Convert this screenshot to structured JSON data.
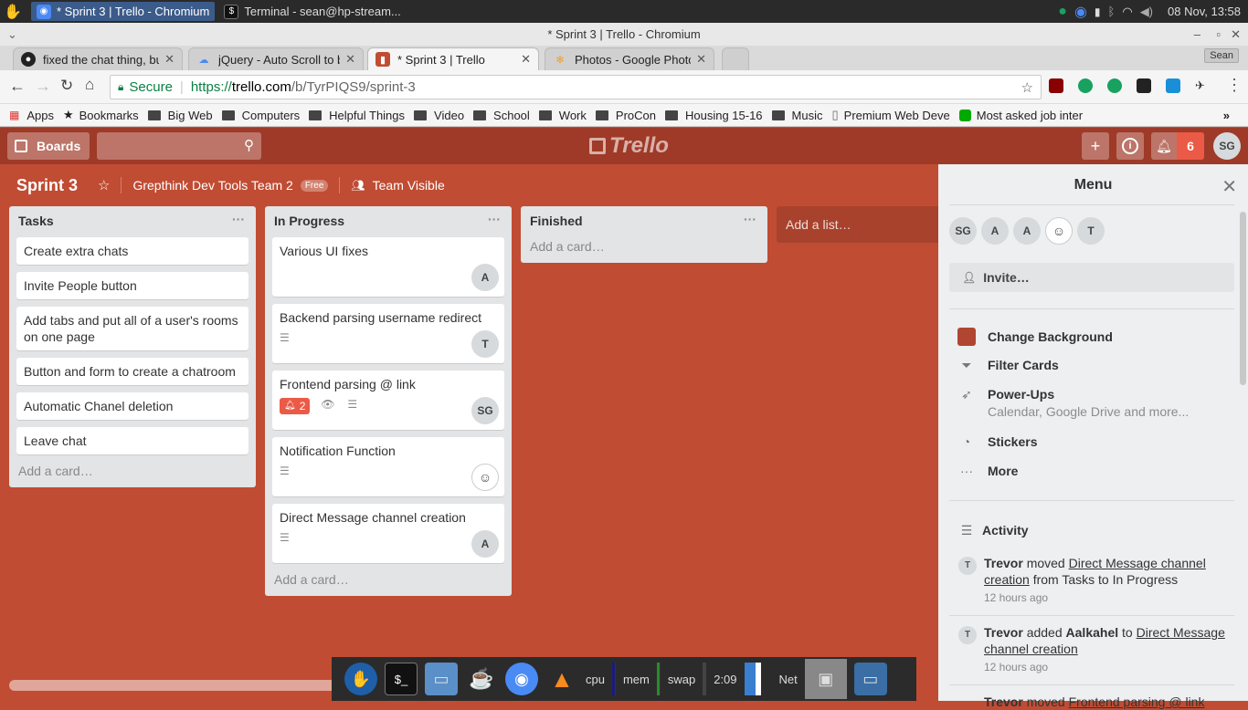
{
  "os": {
    "tasks": [
      {
        "label": "* Sprint 3 | Trello - Chromium",
        "icon": "chromium-icon"
      },
      {
        "label": "Terminal - sean@hp-stream...",
        "icon": "terminal-icon"
      }
    ],
    "clock": "08 Nov, 13:58"
  },
  "window": {
    "title": "* Sprint 3 | Trello - Chromium"
  },
  "tabs": [
    {
      "label": "fixed the chat thing, but",
      "icon": "github-icon"
    },
    {
      "label": "jQuery - Auto Scroll to b",
      "icon": "cloud-icon"
    },
    {
      "label": "* Sprint 3 | Trello",
      "icon": "trello-icon"
    },
    {
      "label": "Photos - Google Photos",
      "icon": "google-photos-icon"
    }
  ],
  "address": {
    "secure_label": "Secure",
    "url_prefix": "https://",
    "url_domain": "trello.com",
    "url_path": "/b/TyrPIQS9/sprint-3"
  },
  "profile_name": "Sean",
  "bookmarks": [
    {
      "label": "Apps",
      "icon": "apps-icon"
    },
    {
      "label": "Bookmarks",
      "icon": "star-icon"
    },
    {
      "label": "Big Web",
      "icon": "folder-icon"
    },
    {
      "label": "Computers",
      "icon": "folder-icon"
    },
    {
      "label": "Helpful Things",
      "icon": "folder-icon"
    },
    {
      "label": "Video",
      "icon": "folder-icon"
    },
    {
      "label": "School",
      "icon": "folder-icon"
    },
    {
      "label": "Work",
      "icon": "folder-icon"
    },
    {
      "label": "ProCon",
      "icon": "folder-icon"
    },
    {
      "label": "Housing 15-16",
      "icon": "folder-icon"
    },
    {
      "label": "Music",
      "icon": "folder-icon"
    },
    {
      "label": "Premium Web Deve",
      "icon": "page-icon"
    },
    {
      "label": "Most asked job inter",
      "icon": "site-icon"
    }
  ],
  "header": {
    "boards_label": "Boards",
    "logo": "Trello",
    "notif_count": "6",
    "user_initials": "SG"
  },
  "board": {
    "title": "Sprint 3",
    "team": "Grepthink Dev Tools Team 2",
    "team_badge": "Free",
    "visibility": "Team Visible"
  },
  "lists": [
    {
      "title": "Tasks",
      "cards": [
        {
          "title": "Create extra chats"
        },
        {
          "title": "Invite People button"
        },
        {
          "title": "Add tabs and put all of a user's rooms on one page"
        },
        {
          "title": "Button and form to create a chatroom"
        },
        {
          "title": "Automatic Chanel deletion"
        },
        {
          "title": "Leave chat"
        }
      ],
      "add_label": "Add a card…"
    },
    {
      "title": "In Progress",
      "cards": [
        {
          "title": "Various UI fixes",
          "member": "A"
        },
        {
          "title": "Backend parsing username redirect",
          "member": "T"
        },
        {
          "title": "Frontend parsing @ link",
          "member": "SG",
          "notif_badge": "2"
        },
        {
          "title": "Notification Function",
          "member": "doodle-avatar"
        },
        {
          "title": "Direct Message channel creation",
          "member": "A"
        }
      ],
      "add_label": "Add a card…"
    },
    {
      "title": "Finished",
      "cards": [],
      "add_label": "Add a card…"
    }
  ],
  "add_list_label": "Add a list…",
  "menu": {
    "title": "Menu",
    "members": [
      "SG",
      "A",
      "A",
      "doodle-avatar",
      "T"
    ],
    "invite_label": "Invite…",
    "items": [
      {
        "label": "Change Background",
        "icon": "color-swatch-icon"
      },
      {
        "label": "Filter Cards",
        "icon": "filter-icon"
      },
      {
        "label": "Power-Ups",
        "sub": "Calendar, Google Drive and more...",
        "icon": "rocket-icon"
      },
      {
        "label": "Stickers",
        "icon": "sticker-icon"
      },
      {
        "label": "More",
        "icon": "more-icon"
      }
    ],
    "activity_title": "Activity",
    "activity": [
      {
        "avatar": "T",
        "user": "Trevor",
        "action": " moved ",
        "link": "Direct Message channel creation",
        "rest": " from Tasks to In Progress",
        "time": "12 hours ago"
      },
      {
        "avatar": "T",
        "user": "Trevor",
        "action": " added ",
        "target": "Aalkahel",
        "mid": " to ",
        "link": "Direct Message channel creation",
        "time": "12 hours ago"
      },
      {
        "avatar": "T",
        "user": "Trevor",
        "action": " moved ",
        "link": "Frontend parsing @ link"
      }
    ]
  },
  "taskbar": {
    "cpu": "cpu",
    "mem": "mem",
    "swap": "swap",
    "time": "2:09",
    "net": "Net"
  },
  "colors": {
    "board_bg": "#c04c33",
    "header_bg": "#9f3a28",
    "badge_red": "#eb5a46",
    "swatch": "#b04632"
  }
}
